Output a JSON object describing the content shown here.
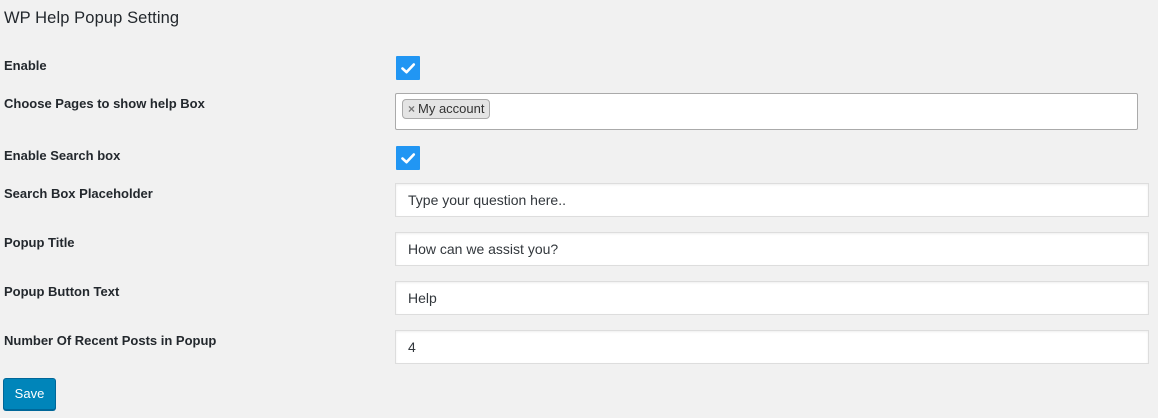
{
  "page": {
    "title": "WP Help Popup Setting"
  },
  "colors": {
    "checkbox_accent": "#2196f3",
    "primary_button": "#0085ba",
    "background": "#f1f1f1"
  },
  "fields": {
    "enable": {
      "label": "Enable",
      "checked": true,
      "icon": "checkmark-icon"
    },
    "pages": {
      "label": "Choose Pages to show help Box",
      "selected": [
        "My account"
      ],
      "remove_glyph": "×"
    },
    "enable_search": {
      "label": "Enable Search box",
      "checked": true,
      "icon": "checkmark-icon"
    },
    "search_placeholder": {
      "label": "Search Box Placeholder",
      "value": "Type your question here.."
    },
    "popup_title": {
      "label": "Popup Title",
      "value": "How can we assist you?"
    },
    "popup_button_text": {
      "label": "Popup Button Text",
      "value": "Help"
    },
    "recent_posts": {
      "label": "Number Of Recent Posts in Popup",
      "value": "4"
    }
  },
  "actions": {
    "save_label": "Save"
  }
}
